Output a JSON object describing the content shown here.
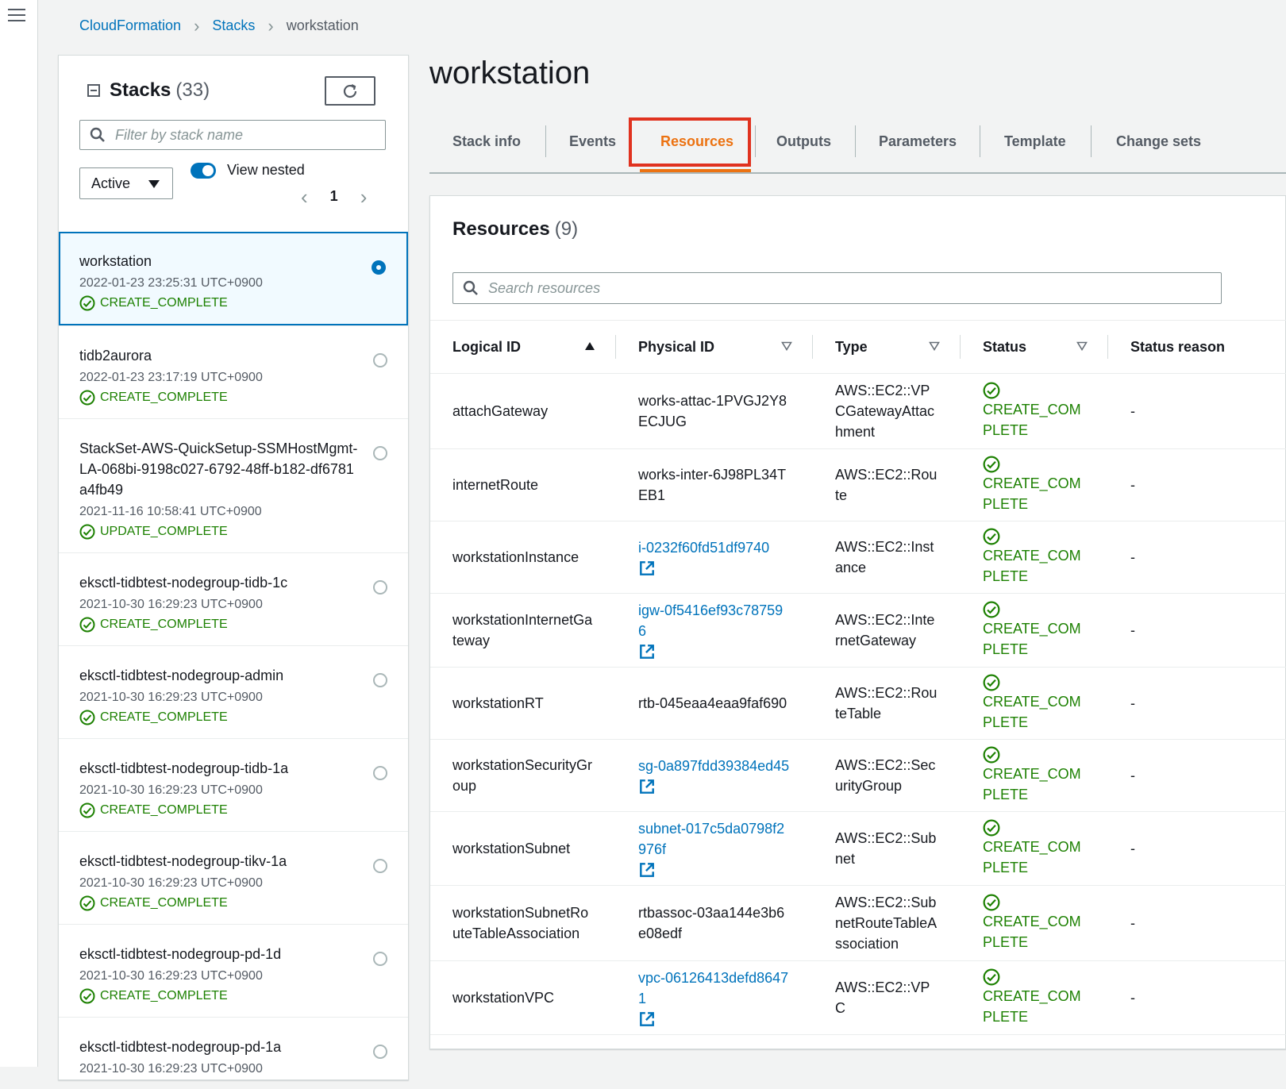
{
  "breadcrumb": {
    "items": [
      "CloudFormation",
      "Stacks"
    ],
    "current": "workstation"
  },
  "stacks_panel": {
    "title": "Stacks",
    "count": "(33)",
    "filter_placeholder": "Filter by stack name",
    "status_filter": "Active",
    "view_nested_label": "View nested",
    "page": "1",
    "stacks": [
      {
        "name": "workstation",
        "date": "2022-01-23 23:25:31 UTC+0900",
        "status": "CREATE_COMPLETE"
      },
      {
        "name": "tidb2aurora",
        "date": "2022-01-23 23:17:19 UTC+0900",
        "status": "CREATE_COMPLETE"
      },
      {
        "name": "StackSet-AWS-QuickSetup-SSMHostMgmt-LA-068bi-9198c027-6792-48ff-b182-df6781a4fb49",
        "date": "2021-11-16 10:58:41 UTC+0900",
        "status": "UPDATE_COMPLETE"
      },
      {
        "name": "eksctl-tidbtest-nodegroup-tidb-1c",
        "date": "2021-10-30 16:29:23 UTC+0900",
        "status": "CREATE_COMPLETE"
      },
      {
        "name": "eksctl-tidbtest-nodegroup-admin",
        "date": "2021-10-30 16:29:23 UTC+0900",
        "status": "CREATE_COMPLETE"
      },
      {
        "name": "eksctl-tidbtest-nodegroup-tidb-1a",
        "date": "2021-10-30 16:29:23 UTC+0900",
        "status": "CREATE_COMPLETE"
      },
      {
        "name": "eksctl-tidbtest-nodegroup-tikv-1a",
        "date": "2021-10-30 16:29:23 UTC+0900",
        "status": "CREATE_COMPLETE"
      },
      {
        "name": "eksctl-tidbtest-nodegroup-pd-1d",
        "date": "2021-10-30 16:29:23 UTC+0900",
        "status": "CREATE_COMPLETE"
      },
      {
        "name": "eksctl-tidbtest-nodegroup-pd-1a",
        "date": "2021-10-30 16:29:23 UTC+0900",
        "status": ""
      }
    ]
  },
  "main": {
    "title": "workstation",
    "tabs": [
      "Stack info",
      "Events",
      "Resources",
      "Outputs",
      "Parameters",
      "Template",
      "Change sets"
    ],
    "active_tab": "Resources"
  },
  "resources": {
    "title": "Resources",
    "count": "(9)",
    "search_placeholder": "Search resources",
    "columns": [
      "Logical ID",
      "Physical ID",
      "Type",
      "Status",
      "Status reason"
    ],
    "rows": [
      {
        "logical_id": "attachGateway",
        "physical_id": "works-attac-1PVGJ2Y8ECJUG",
        "is_link": false,
        "type": "AWS::EC2::VPCGatewayAttachment",
        "status": "CREATE_COMPLETE",
        "reason": "-"
      },
      {
        "logical_id": "internetRoute",
        "physical_id": "works-inter-6J98PL34TEB1",
        "is_link": false,
        "type": "AWS::EC2::Route",
        "status": "CREATE_COMPLETE",
        "reason": "-"
      },
      {
        "logical_id": "workstationInstance",
        "physical_id": "i-0232f60fd51df9740",
        "is_link": true,
        "type": "AWS::EC2::Instance",
        "status": "CREATE_COMPLETE",
        "reason": "-"
      },
      {
        "logical_id": "workstationInternetGateway",
        "physical_id": "igw-0f5416ef93c787596",
        "is_link": true,
        "type": "AWS::EC2::InternetGateway",
        "status": "CREATE_COMPLETE",
        "reason": "-"
      },
      {
        "logical_id": "workstationRT",
        "physical_id": "rtb-045eaa4eaa9faf690",
        "is_link": false,
        "type": "AWS::EC2::RouteTable",
        "status": "CREATE_COMPLETE",
        "reason": "-"
      },
      {
        "logical_id": "workstationSecurityGroup",
        "physical_id": "sg-0a897fdd39384ed45",
        "is_link": true,
        "type": "AWS::EC2::SecurityGroup",
        "status": "CREATE_COMPLETE",
        "reason": "-"
      },
      {
        "logical_id": "workstationSubnet",
        "physical_id": "subnet-017c5da0798f2976f",
        "is_link": true,
        "type": "AWS::EC2::Subnet",
        "status": "CREATE_COMPLETE",
        "reason": "-"
      },
      {
        "logical_id": "workstationSubnetRouteTableAssociation",
        "physical_id": "rtbassoc-03aa144e3b6e08edf",
        "is_link": false,
        "type": "AWS::EC2::SubnetRouteTableAssociation",
        "status": "CREATE_COMPLETE",
        "reason": "-"
      },
      {
        "logical_id": "workstationVPC",
        "physical_id": "vpc-06126413defd86471",
        "is_link": true,
        "type": "AWS::EC2::VPC",
        "status": "CREATE_COMPLETE",
        "reason": "-"
      }
    ]
  },
  "colors": {
    "link": "#0073bb",
    "success": "#1d8102",
    "active_tab": "#ec7211",
    "highlight": "#e0321f"
  }
}
